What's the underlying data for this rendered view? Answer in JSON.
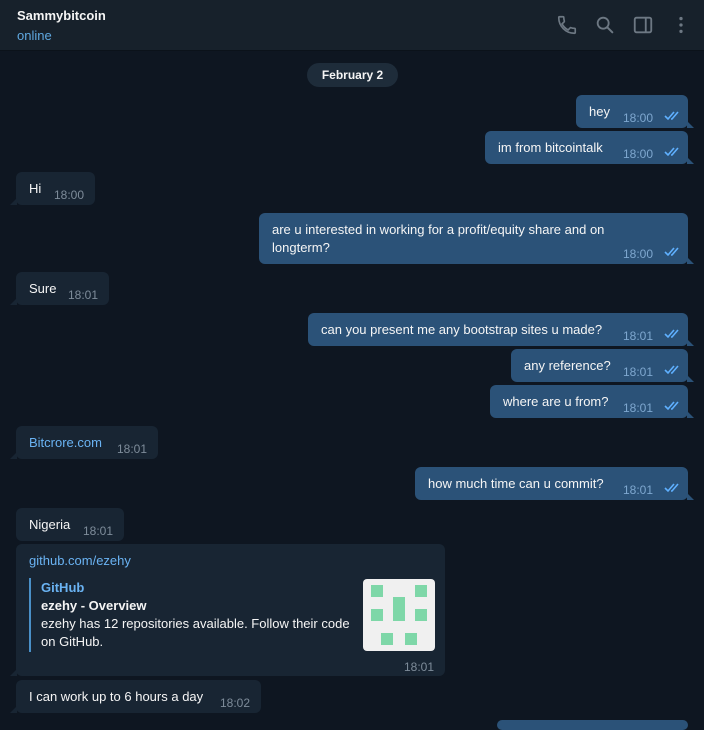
{
  "header": {
    "title": "Sammybitcoin",
    "status": "online"
  },
  "date_separator": "February 2",
  "messages": [
    {
      "dir": "out",
      "text": "hey",
      "time": "18:00"
    },
    {
      "dir": "out",
      "text": "im from bitcointalk",
      "time": "18:00"
    },
    {
      "dir": "in",
      "text": "Hi",
      "time": "18:00"
    },
    {
      "dir": "out",
      "text_line1": "are u interested in working for a profit/equity share and on",
      "text_line2": "longterm?",
      "time": "18:00"
    },
    {
      "dir": "in",
      "text": "Sure",
      "time": "18:01"
    },
    {
      "dir": "out",
      "text": "can you present me any bootstrap sites u made?",
      "time": "18:01"
    },
    {
      "dir": "out",
      "text": "any reference?",
      "time": "18:01"
    },
    {
      "dir": "out",
      "text": "where are u from?",
      "time": "18:01"
    },
    {
      "dir": "in",
      "text": "Bitcrore.com",
      "time": "18:01"
    },
    {
      "dir": "out",
      "text": "how much time can u commit?",
      "time": "18:01"
    },
    {
      "dir": "in",
      "text": "Nigeria",
      "time": "18:01"
    },
    {
      "dir": "in",
      "text": "github.com/ezehy",
      "time": "18:01",
      "preview": {
        "site": "GitHub",
        "title": "ezehy - Overview",
        "description": "ezehy has 12 repositories available. Follow their code on GitHub."
      }
    },
    {
      "dir": "in",
      "text": "I can work up to 6 hours a day",
      "time": "18:02"
    }
  ],
  "icons": [
    "phone-icon",
    "search-icon",
    "sidebar-toggle-icon",
    "more-vertical-icon"
  ],
  "colors": {
    "background": "#0e1621",
    "incoming": "#182533",
    "outgoing": "#2b5278",
    "accent": "#6ab3f3"
  }
}
